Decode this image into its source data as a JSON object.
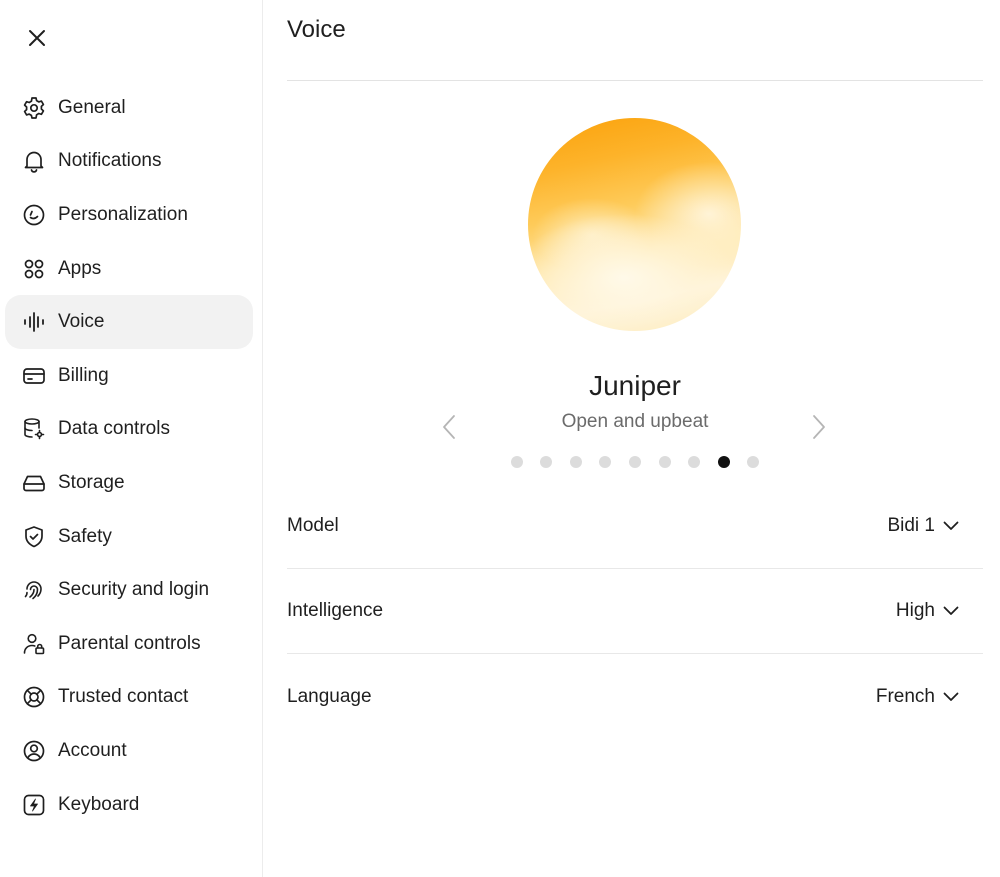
{
  "sidebar": {
    "close_icon": "close-icon",
    "items": [
      {
        "label": "General",
        "icon": "gear-icon"
      },
      {
        "label": "Notifications",
        "icon": "bell-icon"
      },
      {
        "label": "Personalization",
        "icon": "smile-circle-icon"
      },
      {
        "label": "Apps",
        "icon": "apps-grid-icon"
      },
      {
        "label": "Voice",
        "icon": "voice-wave-icon",
        "active": true
      },
      {
        "label": "Billing",
        "icon": "credit-card-icon"
      },
      {
        "label": "Data controls",
        "icon": "database-gear-icon"
      },
      {
        "label": "Storage",
        "icon": "storage-drive-icon"
      },
      {
        "label": "Safety",
        "icon": "shield-check-icon"
      },
      {
        "label": "Security and login",
        "icon": "fingerprint-icon"
      },
      {
        "label": "Parental controls",
        "icon": "person-lock-icon"
      },
      {
        "label": "Trusted contact",
        "icon": "lifebuoy-icon"
      },
      {
        "label": "Account",
        "icon": "user-circle-icon"
      },
      {
        "label": "Keyboard",
        "icon": "keyboard-bolt-icon"
      }
    ]
  },
  "main": {
    "title": "Voice",
    "voice": {
      "name": "Juniper",
      "description": "Open and upbeat",
      "total": 9,
      "selected_index": 7
    },
    "settings": [
      {
        "label": "Model",
        "value": "Bidi 1"
      },
      {
        "label": "Intelligence",
        "value": "High"
      },
      {
        "label": "Language",
        "value": "French"
      }
    ]
  },
  "colors": {
    "accent_dot": "#111111",
    "inactive_dot": "#dcdcdc",
    "active_nav_bg": "#f2f2f2",
    "orb_top": "#fba10a",
    "orb_bottom": "#fff4da"
  }
}
